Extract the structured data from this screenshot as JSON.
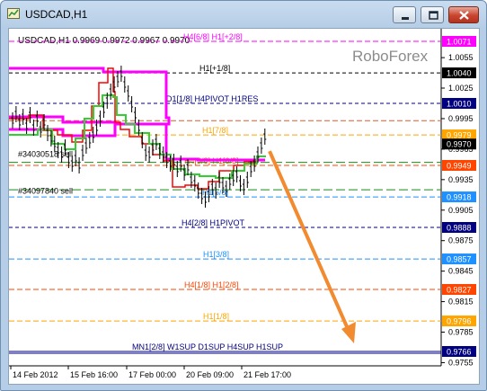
{
  "window": {
    "title": "USDCAD,H1",
    "buttons": [
      "minimize",
      "maximize",
      "close"
    ]
  },
  "chart": {
    "symbol_info": "USDCAD,H1  0.9969 0.9972 0.9967 0.9970",
    "watermark": "RoboForex",
    "current_price": "0.9970",
    "price_ticks": [
      "1.0055",
      "1.0025",
      "0.9995",
      "0.9965",
      "0.9935",
      "0.9905",
      "0.9875",
      "0.9845",
      "0.9815",
      "0.9785",
      "0.9755"
    ],
    "time_ticks": [
      "14 Feb 2012",
      "15 Feb 16:00",
      "17 Feb 00:00",
      "20 Feb 09:00",
      "21 Feb 17:00"
    ],
    "levels": [
      {
        "label": "H4[6/8] H1[+2/8]",
        "price_label": "1.0071",
        "color": "#ff00ff",
        "price": 1.0071
      },
      {
        "label": "H1[+1/8]",
        "price_label": "1.0040",
        "color": "#000000",
        "price": 1.004
      },
      {
        "label": "D1[1/8] H4PIVOT H1RES",
        "price_label": "1.0010",
        "color": "#000080",
        "price": 1.001
      },
      {
        "label": "",
        "price_label": "",
        "color": "#e05a2b",
        "price": 0.9993
      },
      {
        "label": "H1[7/8]",
        "price_label": "0.9979",
        "color": "#ffa500",
        "price": 0.9979
      },
      {
        "label": "H4[3/8] H1[6/8]",
        "price_label": "0.9949",
        "color": "#ff4500",
        "price": 0.9949
      },
      {
        "label": "H1[5/8]",
        "price_label": "0.9918",
        "color": "#1e90ff",
        "price": 0.9918
      },
      {
        "label": "H4[2/8] H1PIVOT",
        "price_label": "0.9888",
        "color": "#000080",
        "price": 0.9888
      },
      {
        "label": "H1[3/8]",
        "price_label": "0.9857",
        "color": "#1e90ff",
        "price": 0.9857
      },
      {
        "label": "H4[1/8] H1[2/8]",
        "price_label": "0.9827",
        "color": "#ff4500",
        "price": 0.9827
      },
      {
        "label": "H1[1/8]",
        "price_label": "0.9796",
        "color": "#ffa500",
        "price": 0.9796
      },
      {
        "label": "MN1[2/8] W1SUP D1SUP H4SUP H1SUP",
        "price_label": "0.9766",
        "color": "#000080",
        "price": 0.9766
      }
    ],
    "orders": [
      {
        "label": "#34030518 sell",
        "price": 0.996
      },
      {
        "label": "#34097840 sell",
        "price": 0.9924
      }
    ],
    "forecast_arrow": {
      "color": "#f28a30",
      "from_price": 0.9963,
      "to_price": 0.9774
    }
  }
}
